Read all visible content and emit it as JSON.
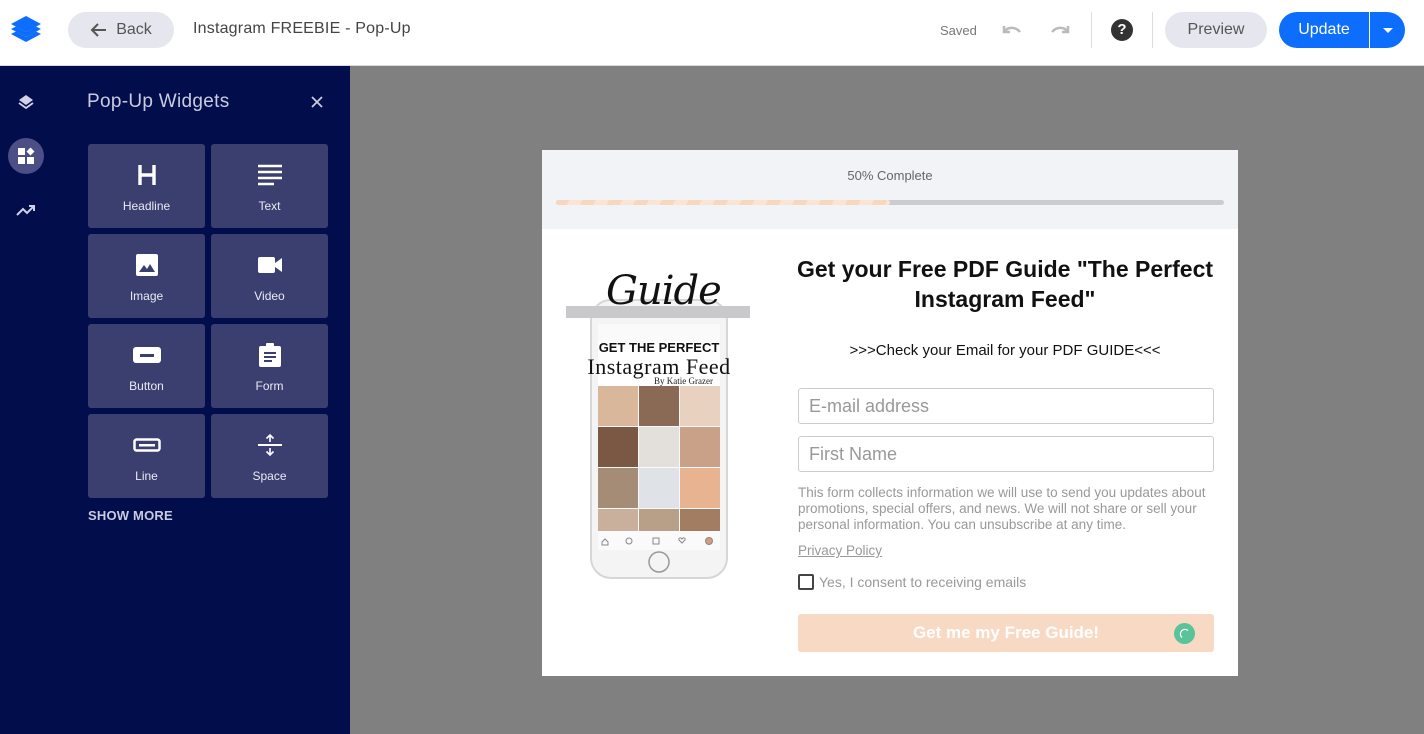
{
  "header": {
    "back_label": "Back",
    "title": "Instagram FREEBIE - Pop-Up",
    "save_status": "Saved",
    "help_label": "?",
    "preview_label": "Preview",
    "update_label": "Update"
  },
  "sidebar": {
    "rail": [
      {
        "name": "layers",
        "active": false
      },
      {
        "name": "widgets",
        "active": true
      },
      {
        "name": "analytics",
        "active": false
      }
    ],
    "panel_title": "Pop-Up Widgets",
    "widgets": [
      {
        "label": "Headline",
        "icon": "headline-icon"
      },
      {
        "label": "Text",
        "icon": "text-icon"
      },
      {
        "label": "Image",
        "icon": "image-icon"
      },
      {
        "label": "Video",
        "icon": "video-icon"
      },
      {
        "label": "Button",
        "icon": "button-icon"
      },
      {
        "label": "Form",
        "icon": "form-icon"
      },
      {
        "label": "Line",
        "icon": "line-icon"
      },
      {
        "label": "Space",
        "icon": "space-icon"
      }
    ],
    "show_more": "SHOW MORE"
  },
  "popup": {
    "progress_label": "50% Complete",
    "progress_fraction": 0.5,
    "hero": {
      "script_title": "Guide",
      "kicker": "GET THE PERFECT",
      "title": "Instagram Feed",
      "byline": "By Katie Grazer"
    },
    "headline": "Get your Free PDF Guide \"The Perfect Instagram Feed\"",
    "subline": ">>>Check your Email for your PDF GUIDE<<<",
    "email_placeholder": "E-mail address",
    "email_value": "",
    "firstname_placeholder": "First Name",
    "firstname_value": "",
    "disclaimer": "This form collects information we will use to send you updates about promotions, special offers, and news. We will not share or sell your personal information. You can unsubscribe at any time.",
    "privacy_link": "Privacy Policy",
    "consent_label": "Yes, I consent to receiving emails",
    "consent_checked": false,
    "cta_label": "Get me my Free Guide!"
  },
  "colors": {
    "brand_blue": "#0d6efd",
    "sidebar_bg": "#020d4b",
    "widget_bg": "#3b3f6f",
    "cta_bg": "#f8d9c3",
    "spinner": "#5ac39a"
  }
}
